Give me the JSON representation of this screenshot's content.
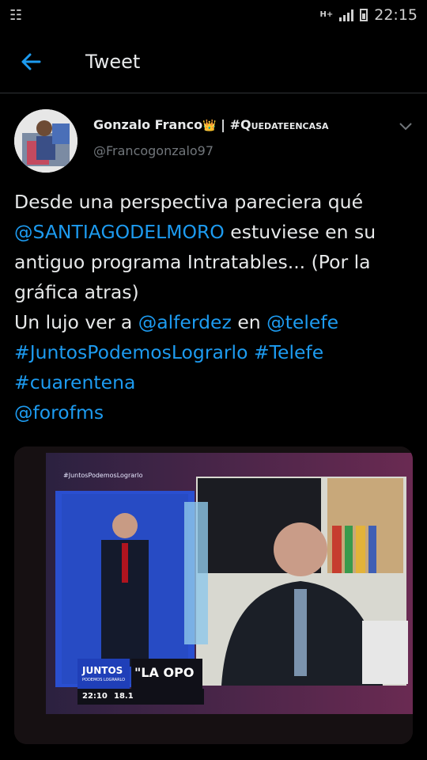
{
  "status": {
    "left_icon": "notification-list-icon",
    "network": "H+",
    "time": "22:15"
  },
  "header": {
    "back_icon": "back-arrow-icon",
    "title": "Tweet"
  },
  "tweet": {
    "name": "Gonzalo Franco",
    "name_emoji": "👑",
    "name_suffix": " | #Quedateencasa",
    "handle": "@Francogonzalo97",
    "menu_icon": "chevron-down-icon",
    "text_parts": [
      {
        "text": "Desde una perspectiva pareciera qué\n",
        "link": false
      },
      {
        "text": "@SANTIAGODELMORO",
        "link": true
      },
      {
        "text": " estuviese en su\nantiguo programa Intratables... (Por la\ngráfica atras)\nUn lujo ver a ",
        "link": false
      },
      {
        "text": "@alferdez",
        "link": true
      },
      {
        "text": " en ",
        "link": false
      },
      {
        "text": "@telefe",
        "link": true
      },
      {
        "text": "\n",
        "link": false
      },
      {
        "text": "#JuntosPodemosLograrlo",
        "link": true
      },
      {
        "text": " ",
        "link": false
      },
      {
        "text": "#Telefe",
        "link": true
      },
      {
        "text": "\n",
        "link": false
      },
      {
        "text": "#cuarentena",
        "link": true
      },
      {
        "text": "\n",
        "link": false
      },
      {
        "text": "@forofms",
        "link": true
      }
    ]
  },
  "media": {
    "hashtag_overlay": "#JuntosPodemosLograrlo",
    "brand": "JUNTOS",
    "brand_sub": "PODEMOS LOGRARLO",
    "headline": "\"LA OPO",
    "clock": "22:10",
    "temp": "18.1"
  }
}
